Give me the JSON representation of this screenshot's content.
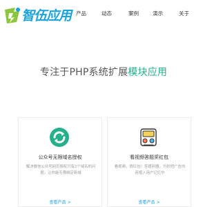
{
  "logo": {
    "text": "智伍应用"
  },
  "nav": {
    "items": [
      {
        "label": "产品"
      },
      {
        "label": "动态"
      },
      {
        "label": "案例"
      },
      {
        "label": "演示"
      },
      {
        "label": "关于"
      }
    ]
  },
  "hero": {
    "title_prefix": "专注于PHP系统扩展",
    "title_accent": "模块应用"
  },
  "cards": [
    {
      "title": "公众号无限域名授权",
      "desc": "解决微信公众号网页授权只有2个域名的问题，让你能无限绑定新域",
      "link": "查看产品 >"
    },
    {
      "title": "看视频答题奖红包",
      "desc": "看视频，猜红包！答题利器，巧妙把广告内容植入用户记忆中",
      "link": "查看产品 >"
    }
  ],
  "colors": {
    "brand_blue": "#19a3dc",
    "accent_green": "#27b08c",
    "link_blue": "#21a0dc"
  }
}
